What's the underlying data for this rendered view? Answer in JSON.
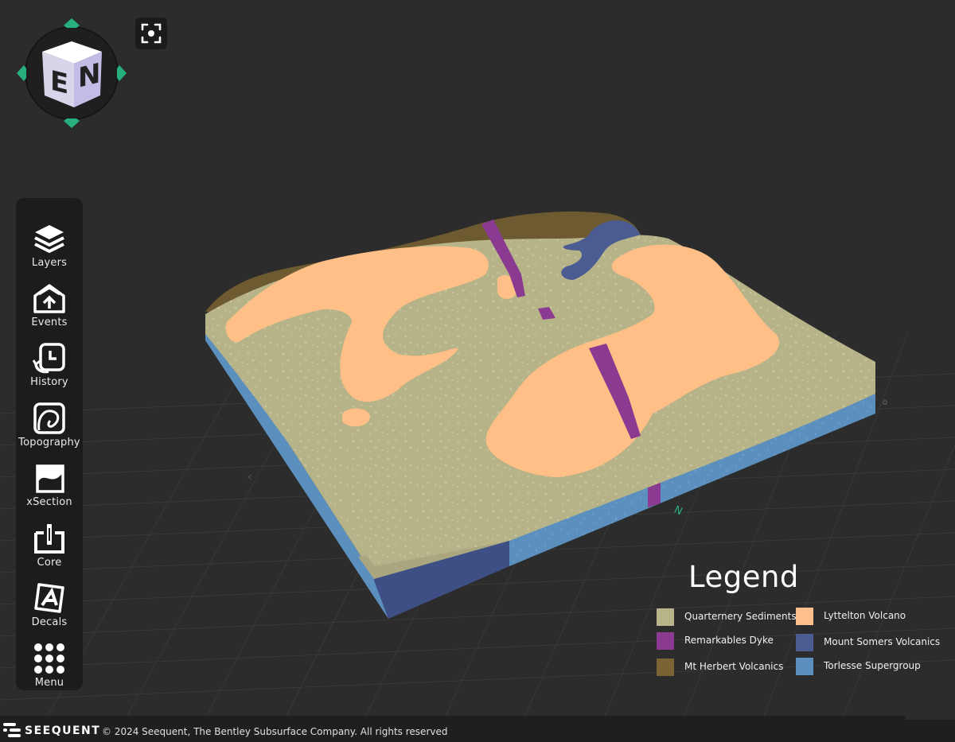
{
  "toolbar": {
    "items": [
      {
        "label": "Layers",
        "icon": "layers-icon"
      },
      {
        "label": "Events",
        "icon": "events-icon"
      },
      {
        "label": "History",
        "icon": "history-icon"
      },
      {
        "label": "Topography",
        "icon": "topography-icon"
      },
      {
        "label": "xSection",
        "icon": "xsection-icon"
      },
      {
        "label": "Core",
        "icon": "core-icon"
      },
      {
        "label": "Decals",
        "icon": "decals-icon"
      },
      {
        "label": "Menu",
        "icon": "menu-grid-icon"
      }
    ]
  },
  "nav_cube": {
    "face_left": "E",
    "face_right": "N",
    "arrow_color": "#27b07e"
  },
  "compass_label": "N",
  "legend": {
    "title": "Legend",
    "items": [
      {
        "label": "Quarternery Sediments",
        "color": "#b9b58a"
      },
      {
        "label": "Lyttelton Volcano",
        "color": "#ffc18c"
      },
      {
        "label": "Remarkables Dyke",
        "color": "#8b3a92"
      },
      {
        "label": "Mount Somers Volcanics",
        "color": "#4b5c92"
      },
      {
        "label": "Mt Herbert Volcanics",
        "color": "#7b6434"
      },
      {
        "label": "Torlesse Supergroup",
        "color": "#5b8fbd"
      }
    ]
  },
  "footer": {
    "brand": "SEEQUENT",
    "copyright": "© 2024 Seequent, The Bentley Subsurface Company. All rights reserved"
  }
}
